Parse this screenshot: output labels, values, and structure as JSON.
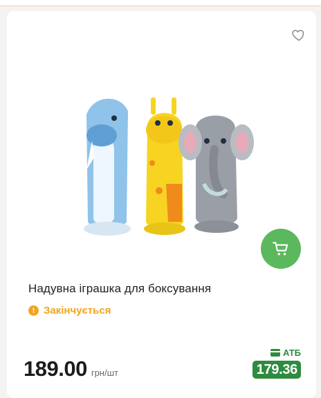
{
  "product": {
    "title": "Надувна іграшка для боксування",
    "status": "Закінчується",
    "price": "189.00",
    "unit": "грн/шт",
    "store_name": "АТБ",
    "store_price": "179.36"
  },
  "icons": {
    "favorite": "heart-icon",
    "cart": "cart-icon",
    "status": "exclamation-icon",
    "store": "card-icon"
  },
  "colors": {
    "accent_green": "#5cb85c",
    "store_green": "#2e8b3f",
    "warning": "#f2a41f"
  }
}
